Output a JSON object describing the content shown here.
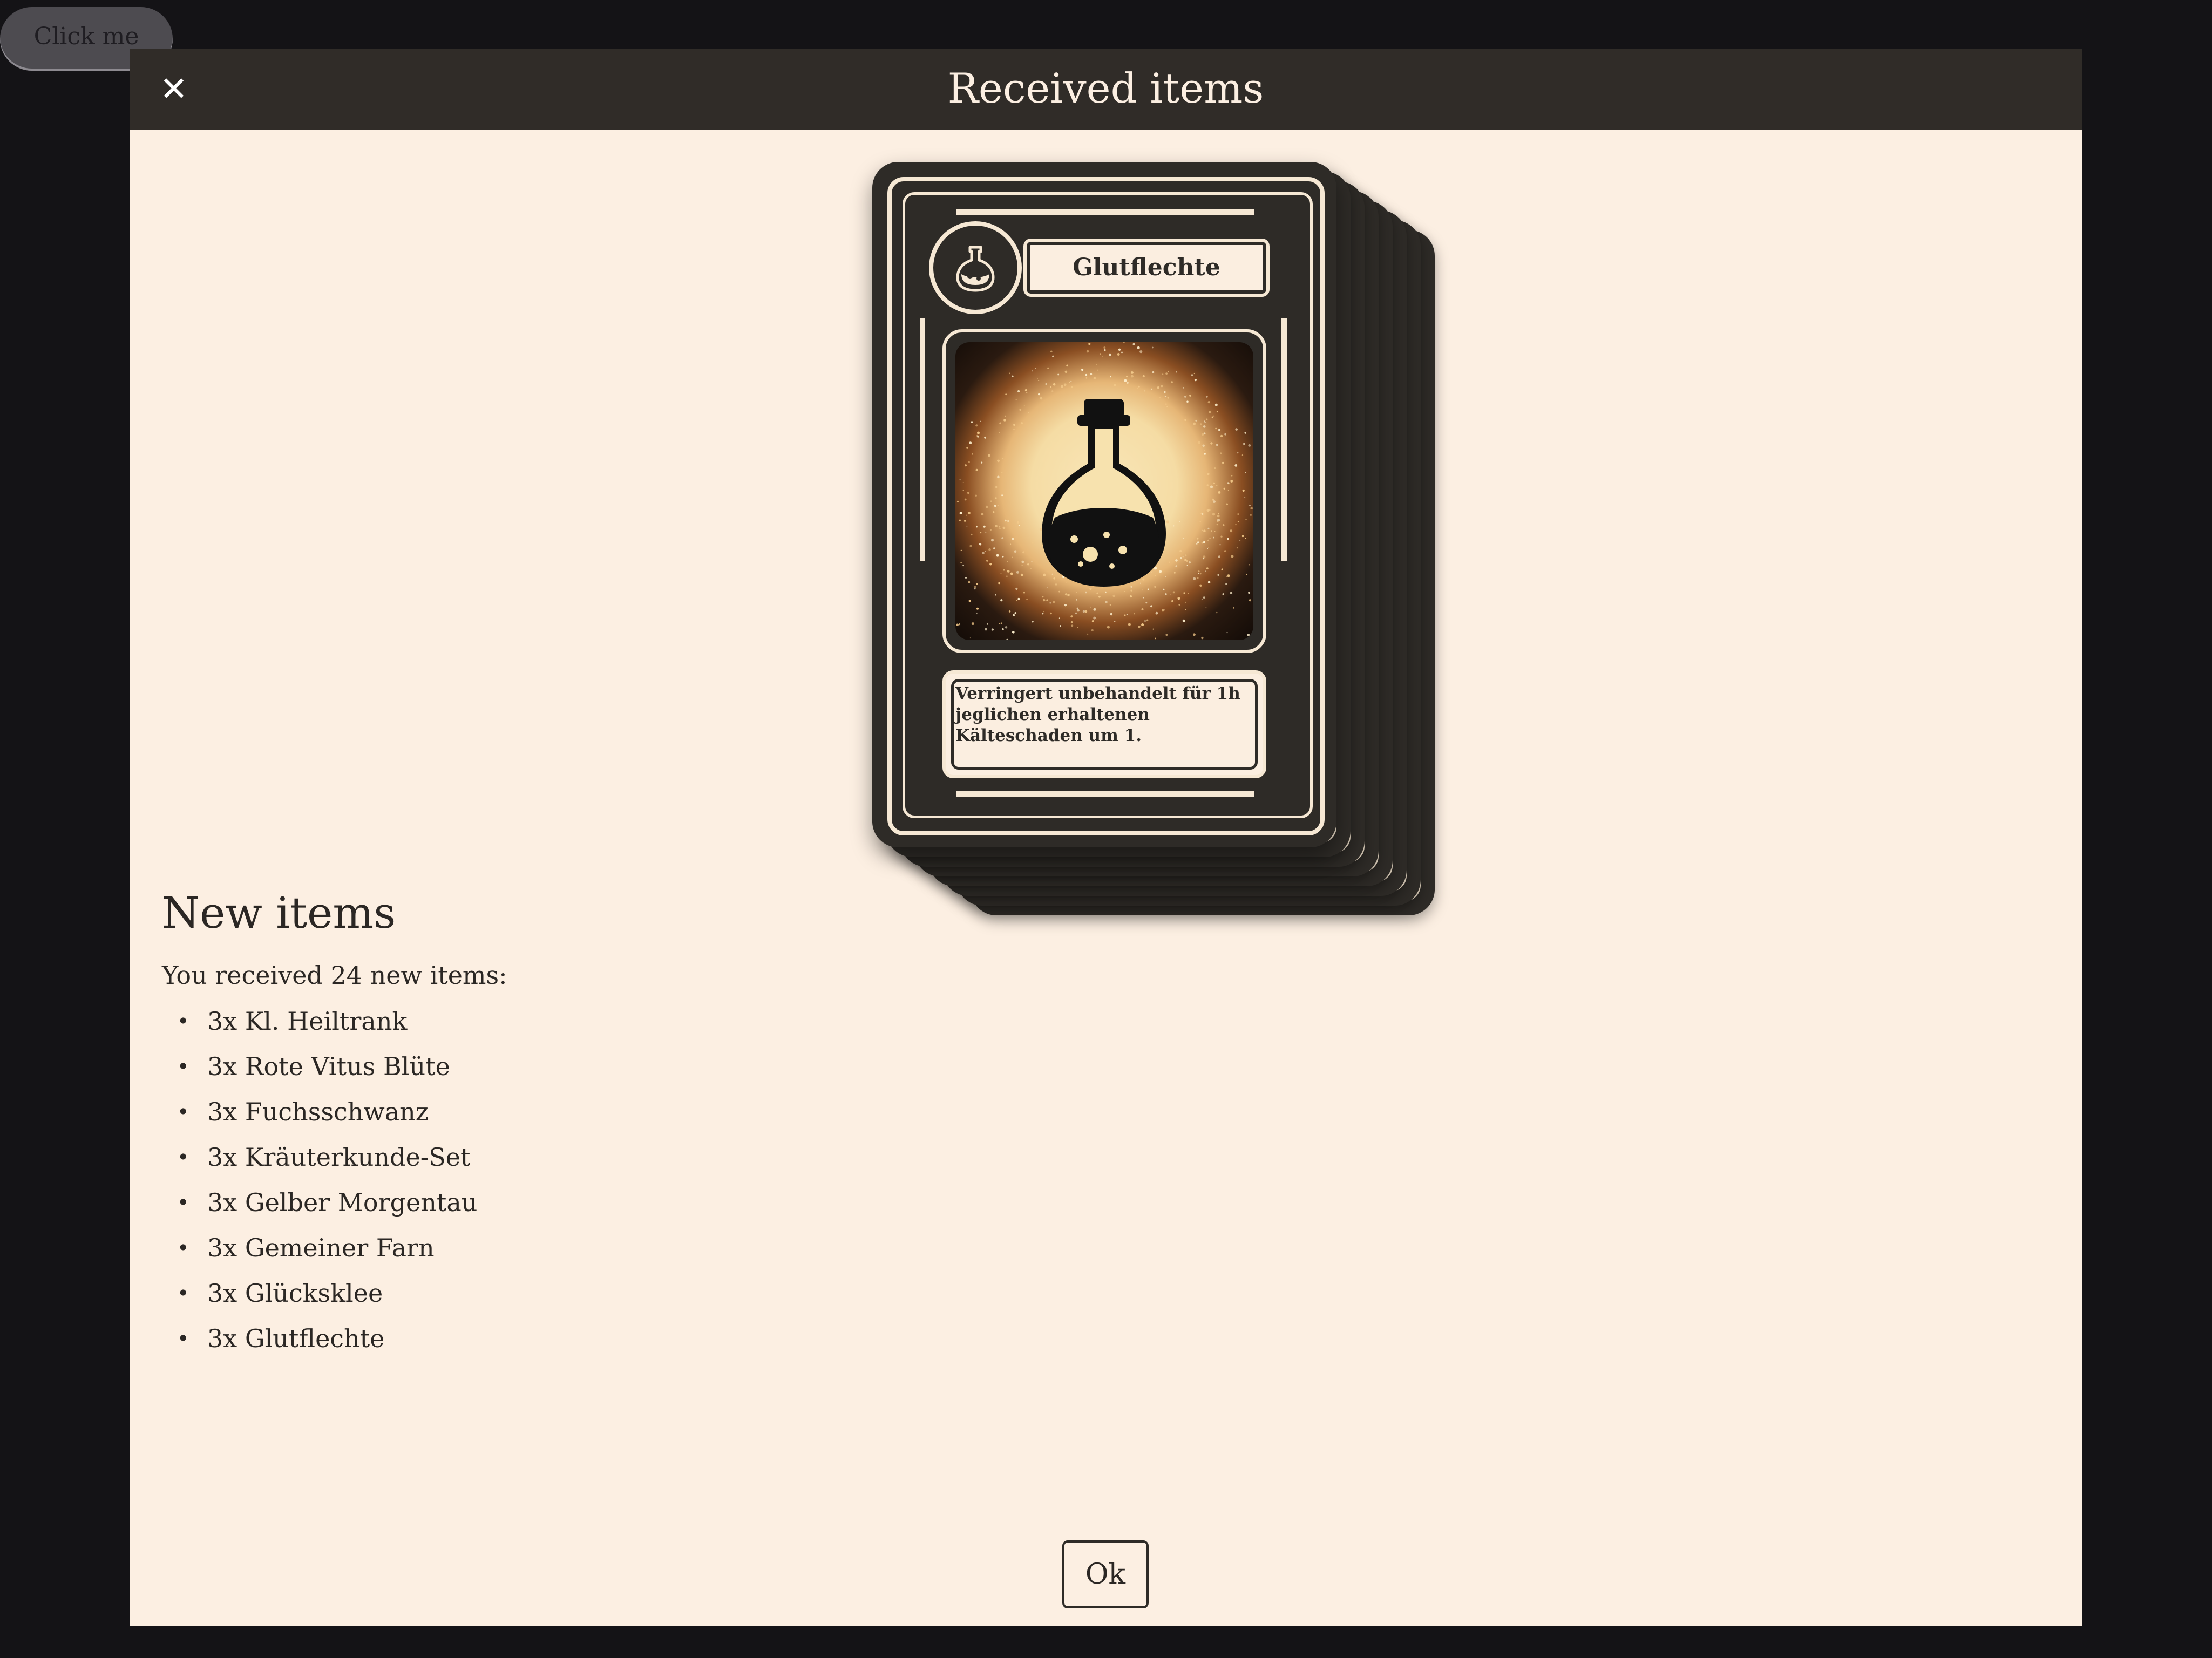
{
  "background_button": {
    "label": "Click me"
  },
  "modal": {
    "title": "Received items",
    "close_icon": "close-icon",
    "ok_label": "Ok"
  },
  "card": {
    "name": "Glutflechte",
    "description": "Verringert unbehandelt für 1h jeglichen erhaltenen Kälteschaden um 1.",
    "icon": "potion-icon",
    "artwork": "potion-bottle-illustration",
    "stack_count": 8
  },
  "new_items": {
    "heading": "New items",
    "intro": "You received 24 new items:",
    "items": [
      "3x Kl. Heiltrank",
      "3x Rote Vitus Blüte",
      "3x Fuchsschwanz",
      "3x Kräuterkunde-Set",
      "3x Gelber Morgentau",
      "3x Gemeiner Farn",
      "3x Glücksklee",
      "3x Glutflechte"
    ]
  },
  "colors": {
    "page_background": "#141316",
    "modal_background": "#fcefe2",
    "header_background": "#302c28",
    "card_dark": "#2e2b27",
    "card_light": "#f6e8d4"
  }
}
